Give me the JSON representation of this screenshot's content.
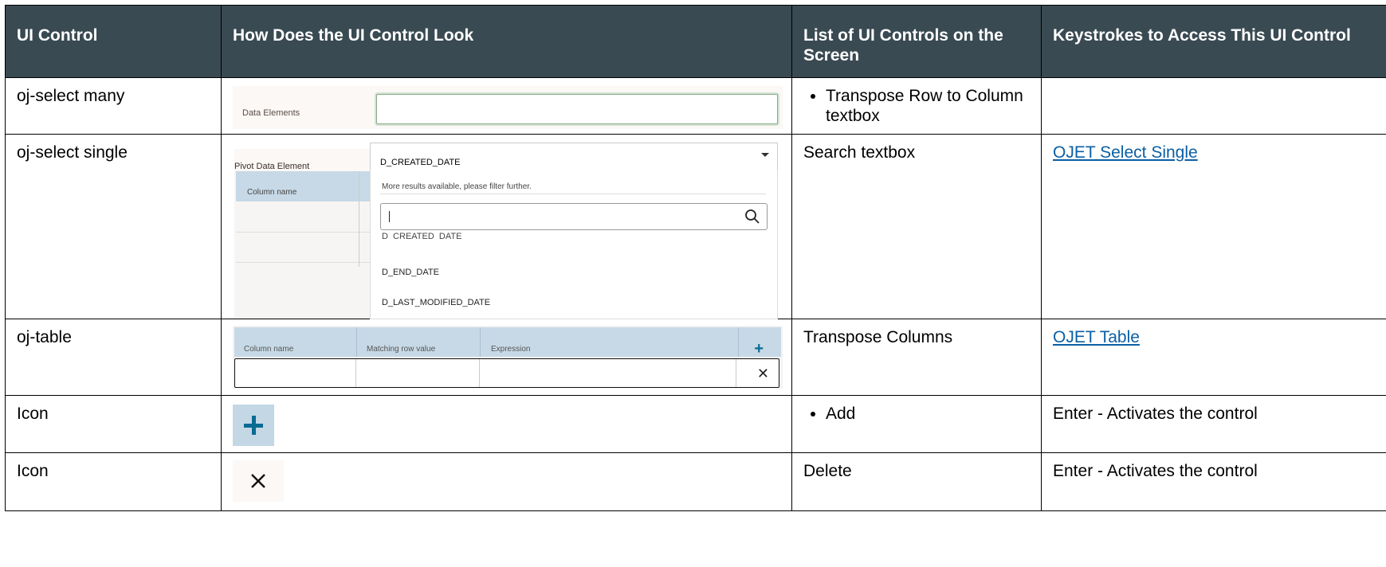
{
  "header": {
    "col1": "UI Control",
    "col2": "How Does the UI Control Look",
    "col3": "List of UI Controls on the Screen",
    "col4": "Keystrokes to Access This UI Control"
  },
  "rows": [
    {
      "control": "oj-select many",
      "screenshot": {
        "label": "Data Elements"
      },
      "list_items": [
        "Transpose Row to Column textbox"
      ],
      "keystrokes": ""
    },
    {
      "control": "oj-select single",
      "screenshot": {
        "label": "Pivot Data Element",
        "selected_value": "D_CREATED_DATE",
        "grid_header": "Column name",
        "more_results": "More results available, please filter further.",
        "options": [
          "D_CREATED_DATE",
          "D_END_DATE",
          "D_LAST_MODIFIED_DATE"
        ]
      },
      "list_text": "Search textbox",
      "keystrokes_link": "OJET Select Single"
    },
    {
      "control": "oj-table",
      "screenshot": {
        "columns": [
          "Column name",
          "Matching row value",
          "Expression"
        ]
      },
      "list_text": "Transpose Columns",
      "keystrokes_link": "OJET Table"
    },
    {
      "control": "Icon",
      "list_items": [
        "Add"
      ],
      "keystrokes": "Enter - Activates the control"
    },
    {
      "control": "Icon",
      "list_text": "Delete",
      "keystrokes": "Enter - Activates the control"
    }
  ],
  "colors": {
    "header_bg": "#3a4a52",
    "link": "#0b5fa5",
    "accent": "#0a6b93"
  },
  "icons": [
    "plus-icon",
    "close-icon",
    "search-icon",
    "caret-down-icon"
  ]
}
